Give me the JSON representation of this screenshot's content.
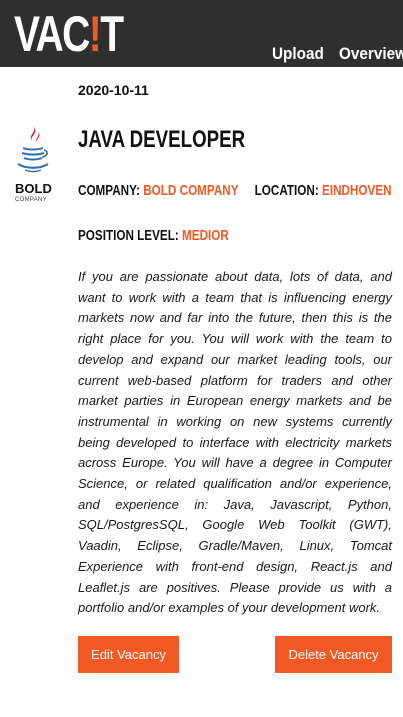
{
  "header": {
    "logo_main": "VAC",
    "logo_bang": "!",
    "logo_tail": "T",
    "nav": {
      "upload": "Upload",
      "overview": "Overview"
    }
  },
  "vacancy": {
    "date": "2020-10-11",
    "company_logo": {
      "icon": "java-icon",
      "name": "BOLD",
      "subtitle": "COMPANY"
    },
    "title": "Java Developer",
    "company_label": "Company:",
    "company": "Bold Company",
    "location_label": "Location:",
    "location": "Eindhoven",
    "level_label": "Position level:",
    "level": "Medior",
    "description": "If you are passionate about data, lots of data, and want to work with a team that is influencing energy markets now and far into the future, then this is the right place for you. You will work with the team to develop and expand our market leading tools, our current web-based platform for traders and other market parties in European energy markets and be instrumental in working on new systems currently being developed to interface with electricity markets across Europe. You will have a degree in Computer Science, or related qualification and/or experience, and experience in: Java, Javascript, Python, SQL/PostgresSQL, Google Web Toolkit (GWT), Vaadin, Eclipse, Gradle/Maven, Linux, Tomcat Experience with front-end design, React.js and Leaflet.js are positives. Please provide us with a portfolio and/or examples of your development work."
  },
  "actions": {
    "edit": "Edit Vacancy",
    "delete": "Delete Vacancy"
  },
  "colors": {
    "accent": "#f15a24",
    "header_bg": "#2f2f2f",
    "java_red": "#e11f21",
    "java_blue": "#2d6fb2"
  }
}
